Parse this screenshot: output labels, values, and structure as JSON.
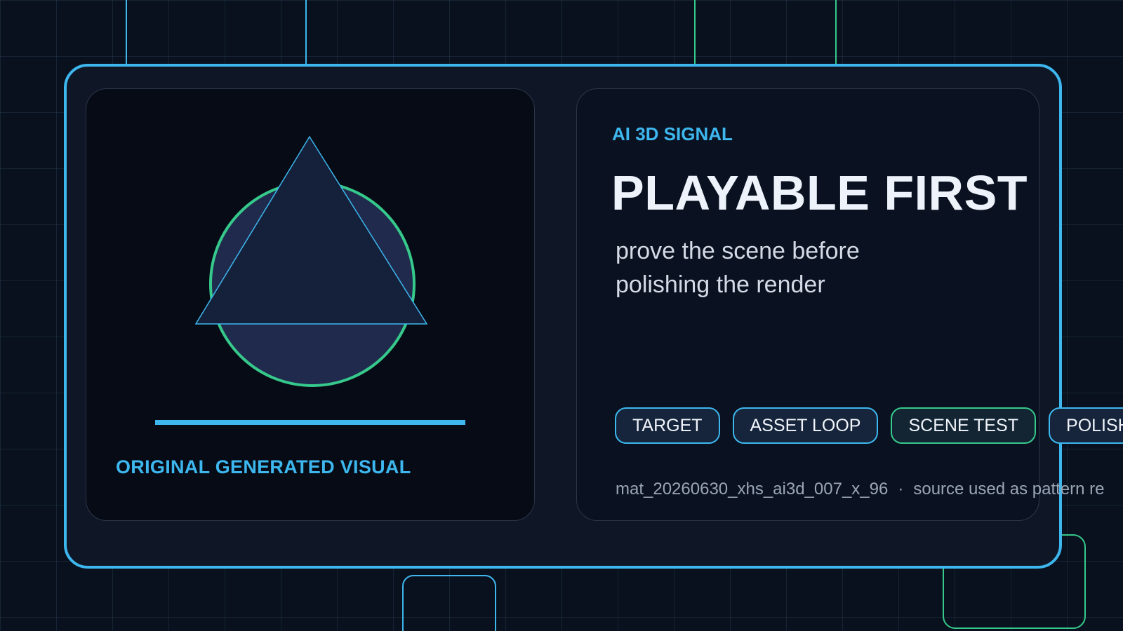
{
  "colors": {
    "background": "#08111d",
    "accent_blue": "#3db7ee",
    "accent_green": "#36c98b",
    "card": "#0f1727",
    "shape_fill": "#15203a",
    "headline": "#eef3fb"
  },
  "visual": {
    "caption": "ORIGINAL GENERATED VISUAL",
    "shapes": [
      "circle-outline",
      "triangle",
      "underline-bar"
    ]
  },
  "info": {
    "kicker": "AI 3D SIGNAL",
    "headline": "PLAYABLE FIRST",
    "subtitle_lines": [
      "prove the scene before",
      "polishing the render"
    ]
  },
  "tags": [
    {
      "label": "TARGET",
      "accent": "blue"
    },
    {
      "label": "ASSET LOOP",
      "accent": "blue"
    },
    {
      "label": "SCENE TEST",
      "accent": "green"
    },
    {
      "label": "POLISH",
      "accent": "blue"
    }
  ],
  "footer": {
    "id": "mat_20260630_xhs_ai3d_007_x_96",
    "separator": "·",
    "note": "source used as pattern re"
  }
}
